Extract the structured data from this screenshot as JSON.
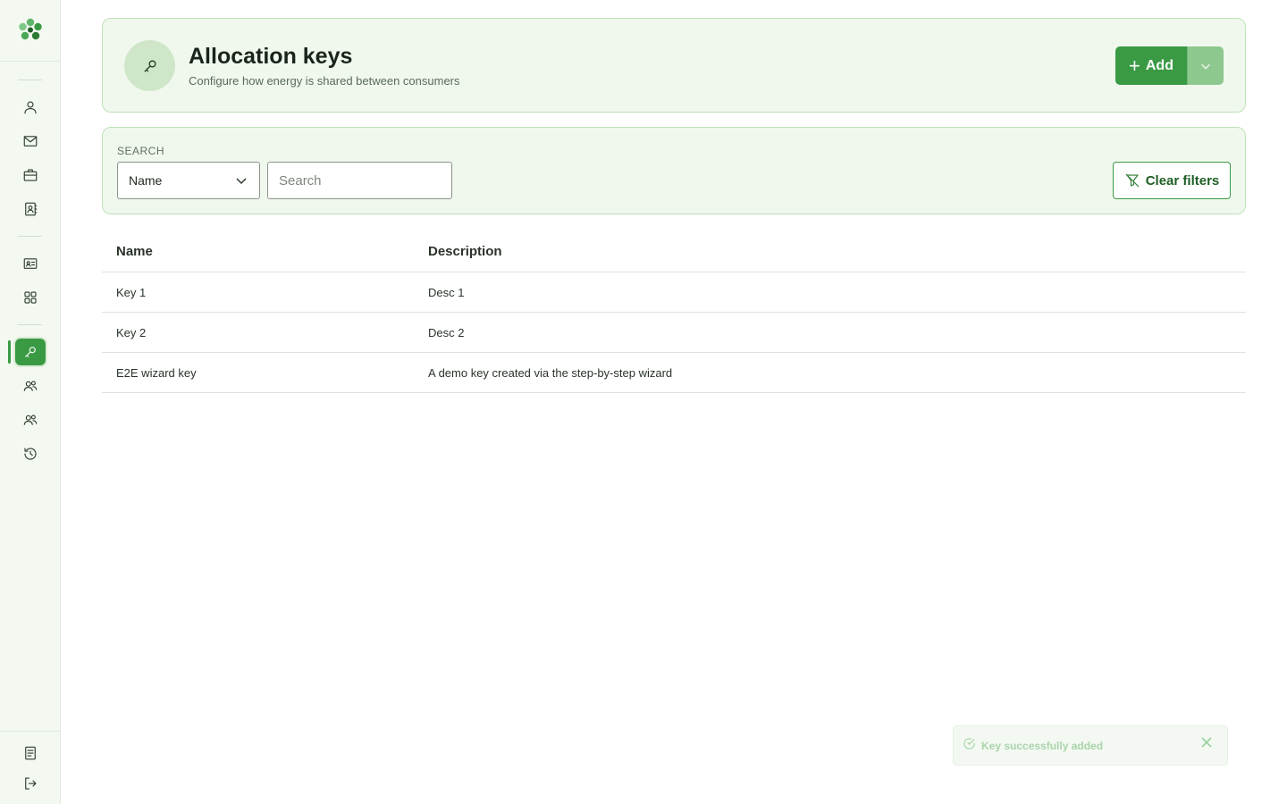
{
  "sidebar": {
    "logo": "clover-logo",
    "items": [
      {
        "icon": "user-icon",
        "name": "sidebar-item-profile"
      },
      {
        "icon": "mail-icon",
        "name": "sidebar-item-messages"
      },
      {
        "icon": "briefcase-icon",
        "name": "sidebar-item-business"
      },
      {
        "icon": "contacts-icon",
        "name": "sidebar-item-contacts"
      },
      {
        "icon": "id-card-icon",
        "name": "sidebar-item-members"
      },
      {
        "icon": "grid-icon",
        "name": "sidebar-item-apps"
      },
      {
        "icon": "key-icon",
        "name": "sidebar-item-allocation-keys",
        "active": true
      },
      {
        "icon": "group-icon",
        "name": "sidebar-item-consumers"
      },
      {
        "icon": "group-icon",
        "name": "sidebar-item-producers"
      },
      {
        "icon": "history-icon",
        "name": "sidebar-item-history"
      },
      {
        "icon": "document-icon",
        "name": "sidebar-item-docs"
      },
      {
        "icon": "logout-icon",
        "name": "sidebar-item-logout"
      }
    ]
  },
  "header": {
    "title": "Allocation keys",
    "subtitle": "Configure how energy is shared between consumers",
    "add_label": "Add"
  },
  "search": {
    "label": "SEARCH",
    "field_selected": "Name",
    "placeholder": "Search",
    "value": "",
    "clear_label": "Clear filters"
  },
  "table": {
    "columns": [
      "Name",
      "Description"
    ],
    "rows": [
      {
        "name": "Key 1",
        "description": "Desc 1"
      },
      {
        "name": "Key 2",
        "description": "Desc 2"
      },
      {
        "name": "E2E wizard key",
        "description": "A demo key created via the step-by-step wizard"
      }
    ]
  },
  "toast": {
    "message": "Key successfully added"
  },
  "colors": {
    "accent": "#3a9a44",
    "card_bg": "#f0f8ee",
    "card_border": "#bfe0b9"
  }
}
